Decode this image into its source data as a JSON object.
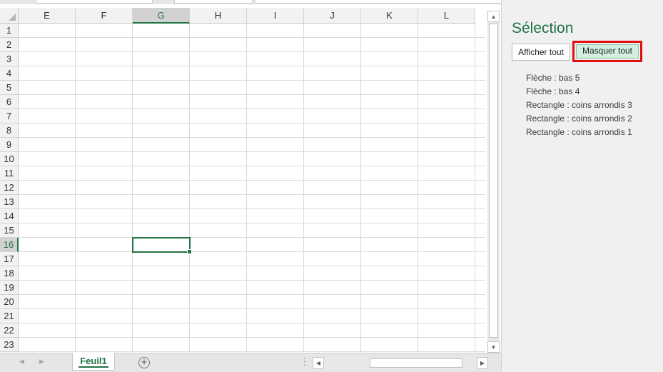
{
  "sheet": {
    "columns": [
      "E",
      "F",
      "G",
      "H",
      "I",
      "J",
      "K",
      "L"
    ],
    "selected_column": "G",
    "rows": [
      "1",
      "2",
      "3",
      "4",
      "5",
      "6",
      "7",
      "8",
      "9",
      "10",
      "11",
      "12",
      "13",
      "14",
      "15",
      "16",
      "17",
      "18",
      "19",
      "20",
      "21",
      "22",
      "23"
    ],
    "selected_row": "16",
    "tab_name": "Feuil1",
    "add_sheet_symbol": "+",
    "accent_color": "#217346"
  },
  "pane": {
    "title": "Sélection",
    "show_all_label": "Afficher tout",
    "hide_all_label": "Masquer tout",
    "highlight_color": "#e01010",
    "objects": [
      "Flèche : bas 5",
      "Flèche : bas 4",
      "Rectangle : coins arrondis 3",
      "Rectangle : coins arrondis 2",
      "Rectangle : coins arrondis 1"
    ]
  }
}
